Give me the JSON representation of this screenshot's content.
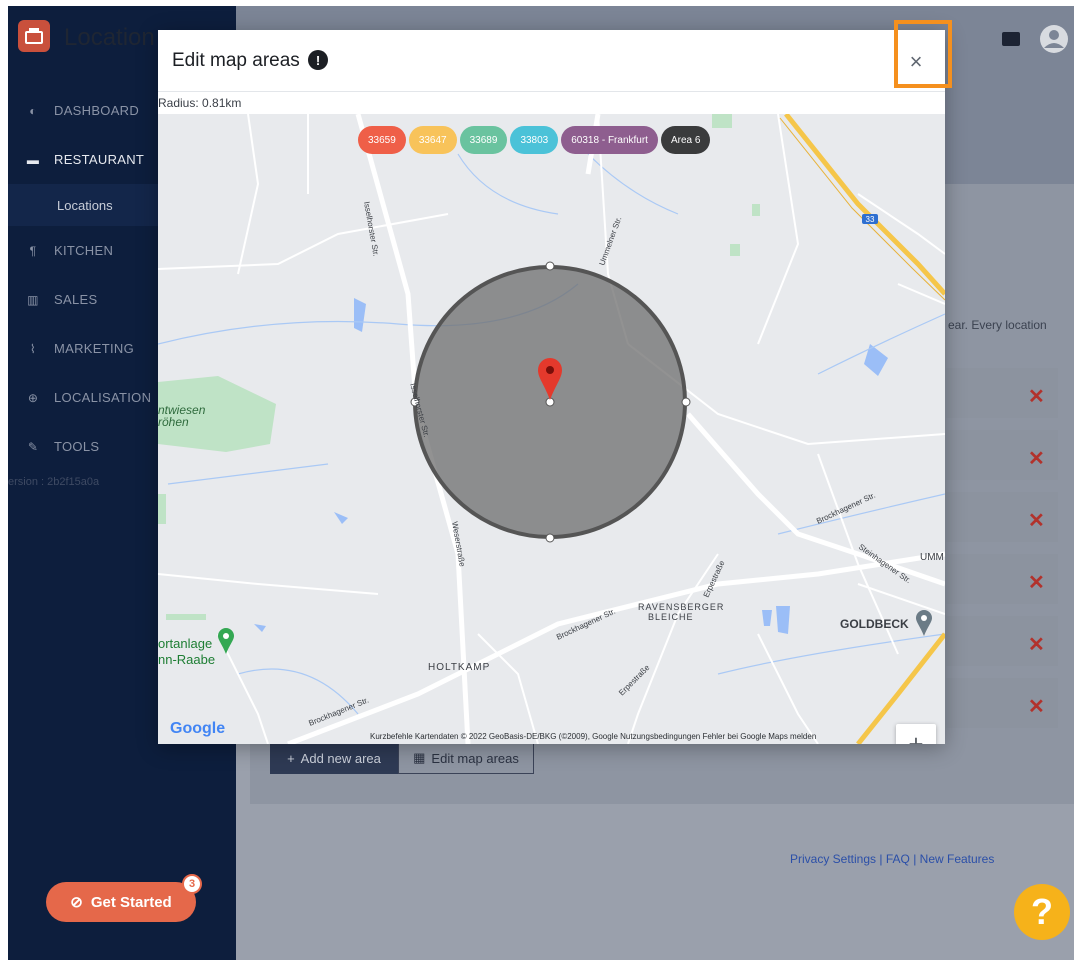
{
  "app": {
    "title": "Location"
  },
  "sidebar": {
    "items": [
      {
        "label": "DASHBOARD",
        "icon": "dashboard-icon"
      },
      {
        "label": "RESTAURANT",
        "icon": "store-icon"
      },
      {
        "label": "Locations",
        "icon": ""
      },
      {
        "label": "KITCHEN",
        "icon": "utensils-icon"
      },
      {
        "label": "SALES",
        "icon": "bar-chart-icon"
      },
      {
        "label": "MARKETING",
        "icon": "line-chart-icon"
      },
      {
        "label": "LOCALISATION",
        "icon": "globe-icon"
      },
      {
        "label": "TOOLS",
        "icon": "wrench-icon"
      }
    ],
    "version": "ersion : 2b2f15a0a"
  },
  "get_started": {
    "label": "Get Started",
    "badge": "3"
  },
  "main": {
    "help_text": "ear. Every location",
    "add_area_label": "Add new area",
    "edit_map_label": "Edit map areas",
    "footer": {
      "privacy": "Privacy Settings",
      "faq": "FAQ",
      "new_features": "New Features"
    }
  },
  "modal": {
    "title": "Edit map areas",
    "close_symbol": "×",
    "radius_text": "Radius: 0.81km",
    "pills": [
      {
        "label": "33659",
        "color": "#ef5f48"
      },
      {
        "label": "33647",
        "color": "#f8c35a"
      },
      {
        "label": "33689",
        "color": "#6ac39f"
      },
      {
        "label": "33803",
        "color": "#4bc2d8"
      },
      {
        "label": "60318 - Frankfurt",
        "color": "#8e5e8f"
      },
      {
        "label": "Area 6",
        "color": "#3a3b3c"
      }
    ],
    "map_labels": {
      "holtkamp": "HOLTKAMP",
      "ravensberger": "RAVENSBERGER",
      "bleiche": "BLEICHE",
      "goldbeck": "GOLDBECK",
      "umm": "UMM",
      "ortanlage": "ortanlage",
      "raabe": "nn-Raabe",
      "twiesen": "ntwiesen",
      "rohen": "röhen",
      "isselhorster": "Isselhorster Str.",
      "ummelner": "Ummelner Str.",
      "weserstrasse": "Weserstraße",
      "brockhagener": "Brockhagener Str.",
      "erpestrasse": "Erpestraße",
      "steinhagener": "Steinhagener Str.",
      "a33": "33"
    },
    "zoom_in": "+",
    "zoom_out": "−",
    "google": "Google",
    "attribution": "Kurzbefehle   Kartendaten © 2022 GeoBasis-DE/BKG (©2009), Google   Nutzungsbedingungen   Fehler bei Google Maps melden"
  }
}
